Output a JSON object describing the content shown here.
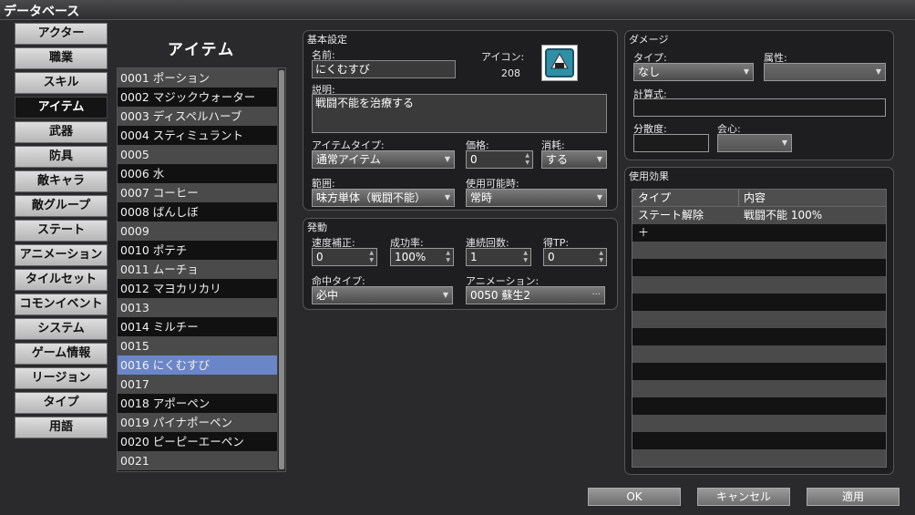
{
  "window": {
    "title": "データベース"
  },
  "categories": [
    "アクター",
    "職業",
    "スキル",
    "アイテム",
    "武器",
    "防具",
    "敵キャラ",
    "敵グループ",
    "ステート",
    "アニメーション",
    "タイルセット",
    "コモンイベント",
    "システム",
    "ゲーム情報",
    "リージョン",
    "タイプ",
    "用語"
  ],
  "selected_category_index": 3,
  "list": {
    "title": "アイテム",
    "items": [
      "0001 ポーション",
      "0002 マジックウォーター",
      "0003 ディスペルハーブ",
      "0004 スティミュラント",
      "0005",
      "0006 水",
      "0007 コーヒー",
      "0008 ばんしぼ",
      "0009",
      "0010 ポテチ",
      "0011 ムーチョ",
      "0012 マヨカリカリ",
      "0013",
      "0014 ミルチー",
      "0015",
      "0016 にくむすび",
      "0017",
      "0018 アポーペン",
      "0019 パイナポーペン",
      "0020 ピーピーエーペン",
      "0021"
    ],
    "selected_index": 15
  },
  "basic": {
    "section": "基本設定",
    "name_label": "名前:",
    "name_value": "にくむすび",
    "icon_label": "アイコン:",
    "icon_index": "208",
    "desc_label": "説明:",
    "desc_value": "戦闘不能を治療する",
    "itemtype_label": "アイテムタイプ:",
    "itemtype_value": "通常アイテム",
    "price_label": "価格:",
    "price_value": "0",
    "consume_label": "消耗:",
    "consume_value": "する",
    "scope_label": "範囲:",
    "scope_value": "味方単体（戦闘不能）",
    "occasion_label": "使用可能時:",
    "occasion_value": "常時"
  },
  "invocation": {
    "section": "発動",
    "speed_label": "速度補正:",
    "speed_value": "0",
    "success_label": "成功率:",
    "success_value": "100%",
    "repeat_label": "連続回数:",
    "repeat_value": "1",
    "tp_label": "得TP:",
    "tp_value": "0",
    "hittype_label": "命中タイプ:",
    "hittype_value": "必中",
    "anim_label": "アニメーション:",
    "anim_value": "0050 蘇生2"
  },
  "damage": {
    "section": "ダメージ",
    "type_label": "タイプ:",
    "type_value": "なし",
    "element_label": "属性:",
    "element_value": "",
    "formula_label": "計算式:",
    "formula_value": "",
    "variance_label": "分散度:",
    "variance_value": "",
    "critical_label": "会心:",
    "critical_value": ""
  },
  "effects": {
    "section": "使用効果",
    "col_type": "タイプ",
    "col_content": "内容",
    "rows": [
      {
        "type": "ステート解除",
        "content": "戦闘不能 100%"
      },
      {
        "type": "＋",
        "content": ""
      }
    ]
  },
  "buttons": {
    "ok": "OK",
    "cancel": "キャンセル",
    "apply": "適用"
  },
  "colors": {
    "selection": "#6a86c8",
    "icon_bg": "#2f8fa6"
  }
}
